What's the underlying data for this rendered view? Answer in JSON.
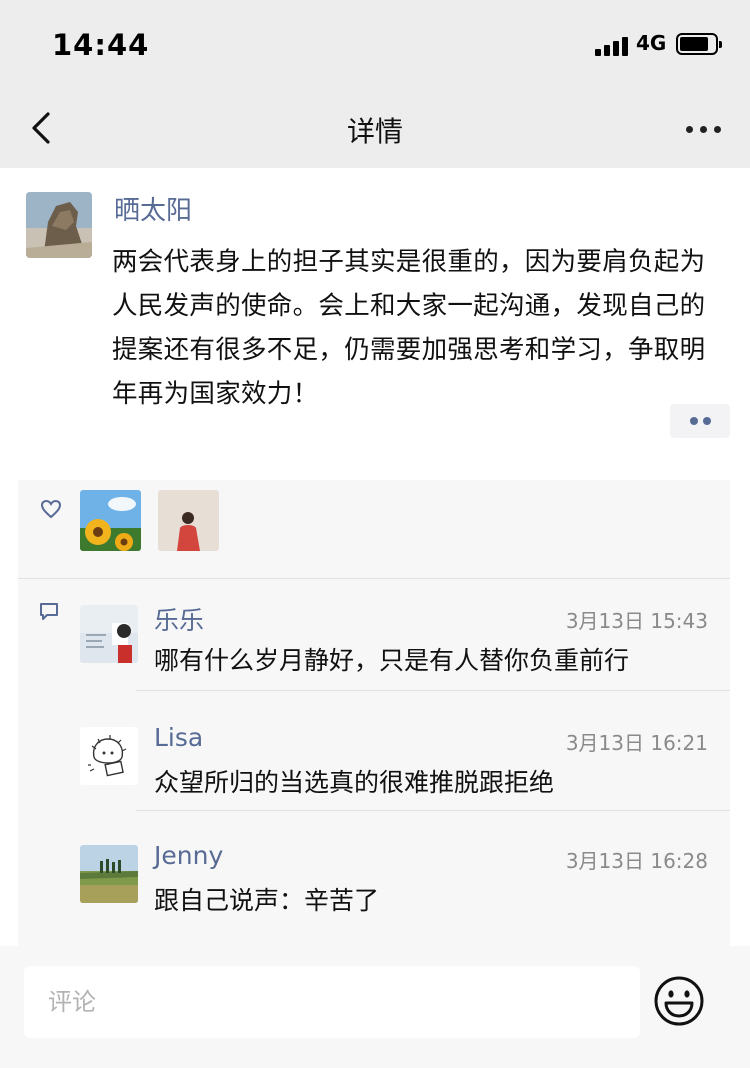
{
  "status_bar": {
    "time": "14:44",
    "network": "4G"
  },
  "nav": {
    "title": "详情"
  },
  "post": {
    "author": "晒太阳",
    "text": "两会代表身上的担子其实是很重的，因为要肩负起为人民发声的使命。会上和大家一起沟通，发现自己的提案还有很多不足，仍需要加强思考和学习，争取明年再为国家效力！"
  },
  "comments": [
    {
      "name": "乐乐",
      "time": "3月13日 15:43",
      "text": "哪有什么岁月静好，只是有人替你负重前行"
    },
    {
      "name": "Lisa",
      "time": "3月13日 16:21",
      "text": "众望所归的当选真的很难推脱跟拒绝"
    },
    {
      "name": "Jenny",
      "time": "3月13日 16:28",
      "text": "跟自己说声：辛苦了"
    }
  ],
  "comment_bar": {
    "placeholder": "评论"
  },
  "colors": {
    "name_link": "#576b95",
    "background": "#ededed",
    "panel": "#f7f7f7"
  },
  "icons": [
    "back-arrow-icon",
    "more-icon",
    "heart-icon",
    "comment-icon",
    "emoji-icon",
    "signal-icon",
    "battery-icon"
  ]
}
